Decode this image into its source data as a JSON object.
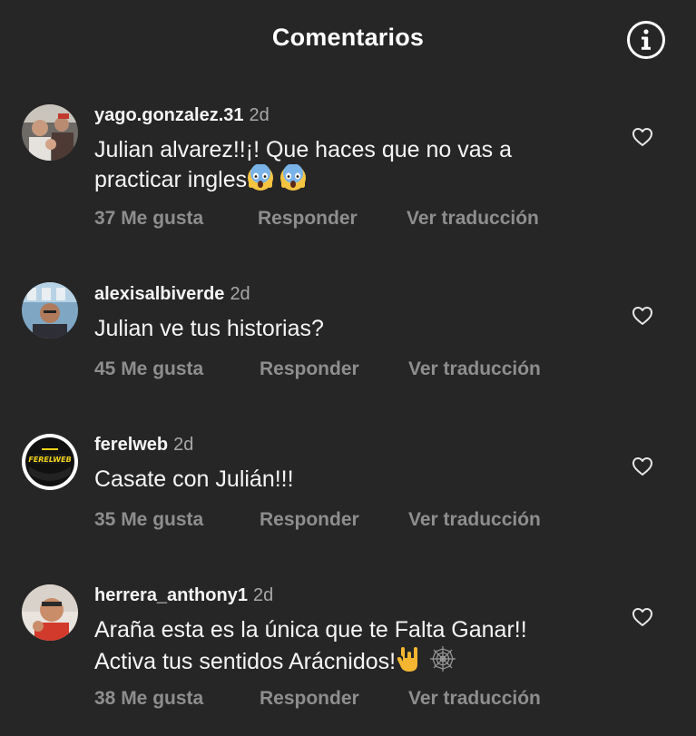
{
  "header": {
    "title": "Comentarios",
    "info_icon": "info-icon"
  },
  "comments": [
    {
      "username": "yago.gonzalez.31",
      "age": "2d",
      "text_line1": "Julian alvarez!!¡! Que haces que no vas a",
      "text_line2": "practicar ingles",
      "emojis": [
        "😱",
        "😱"
      ],
      "likes": "37 Me gusta",
      "reply": "Responder",
      "translate": "Ver traducción"
    },
    {
      "username": "alexisalbiverde",
      "age": "2d",
      "text_line1": "Julian ve tus historias?",
      "likes": "45 Me gusta",
      "reply": "Responder",
      "translate": "Ver traducción"
    },
    {
      "username": "ferelweb",
      "age": "2d",
      "text_line1": "Casate con Julián!!!",
      "likes": "35 Me gusta",
      "reply": "Responder",
      "translate": "Ver traducción",
      "avatar_logo": "FERELWEB"
    },
    {
      "username": "herrera_anthony1",
      "age": "2d",
      "text_line1": "Araña esta es la única que te Falta Ganar!!",
      "text_line2": "Activa  tus sentidos Arácnidos!",
      "emojis": [
        "🤟",
        "🕸"
      ],
      "likes": "38 Me gusta",
      "reply": "Responder",
      "translate": "Ver traducción"
    }
  ],
  "colors": {
    "background": "#262626",
    "text": "#f5f5f5",
    "muted": "#8e8e8e",
    "age": "#a8a8a8"
  }
}
